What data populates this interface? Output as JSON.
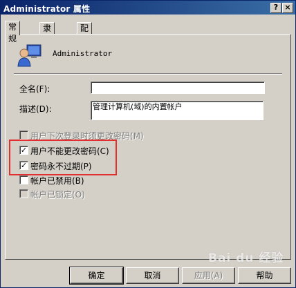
{
  "window": {
    "title": "Administrator 属性",
    "help_button": "?",
    "close_button": "×"
  },
  "tabs": [
    {
      "label": "常规"
    },
    {
      "label": "隶属于"
    },
    {
      "label": "配置文件"
    }
  ],
  "general": {
    "username": "Administrator",
    "fullname_label": "全名(F):",
    "fullname_value": "",
    "description_label": "描述(D):",
    "description_value": "管理计算机(域)的内置帐户"
  },
  "checkboxes": [
    {
      "label": "用户下次登录时须更改密码(M)",
      "checked": false,
      "disabled": true
    },
    {
      "label": "用户不能更改密码(C)",
      "checked": true,
      "disabled": false
    },
    {
      "label": "密码永不过期(P)",
      "checked": true,
      "disabled": false
    },
    {
      "label": "帐户已禁用(B)",
      "checked": false,
      "disabled": false
    },
    {
      "label": "帐户已锁定(O)",
      "checked": false,
      "disabled": true
    }
  ],
  "buttons": {
    "ok": "确定",
    "cancel": "取消",
    "apply": "应用(A)",
    "help": "帮助"
  },
  "watermark": "Bai du 经验",
  "colors": {
    "title_bar": "#0a246a",
    "highlight_box": "#e03030",
    "face": "#d4d0c8"
  }
}
